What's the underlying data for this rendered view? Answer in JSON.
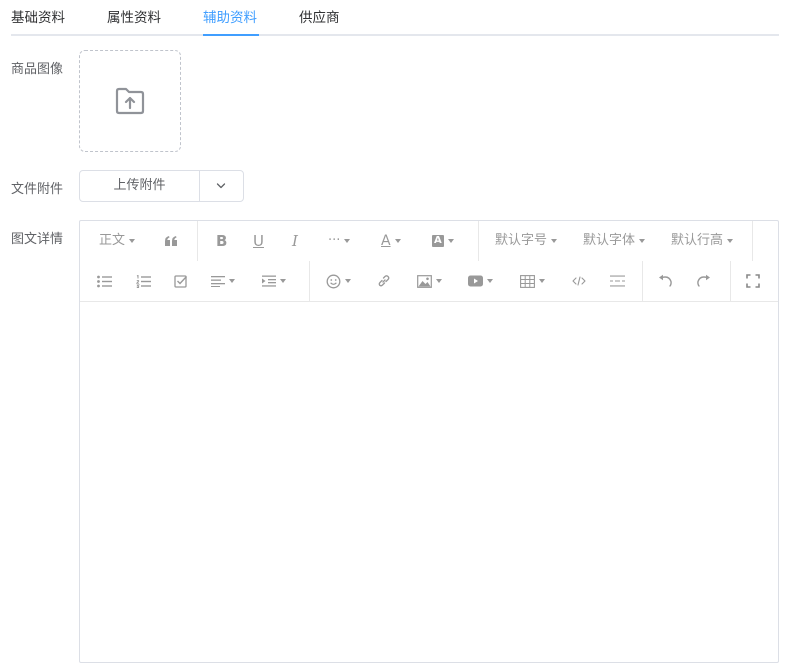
{
  "tabs": [
    {
      "label": "基础资料"
    },
    {
      "label": "属性资料"
    },
    {
      "label": "辅助资料"
    },
    {
      "label": "供应商"
    }
  ],
  "form": {
    "image_label": "商品图像",
    "attachment_label": "文件附件",
    "upload_button_label": "上传附件",
    "detail_label": "图文详情"
  },
  "toolbar": {
    "heading": "正文",
    "font_size": "默认字号",
    "font_family": "默认字体",
    "line_height": "默认行高",
    "font_color_glyph": "A",
    "bg_color_glyph": "A",
    "bold_glyph": "B",
    "underline_glyph": "U",
    "italic_glyph": "I",
    "more_glyph": "···",
    "icons": [
      "quote-icon",
      "bold-icon",
      "underline-icon",
      "italic-icon",
      "more-icon",
      "font-color-icon",
      "bg-color-icon",
      "bulleted-list-icon",
      "numbered-list-icon",
      "todo-icon",
      "justify-icon",
      "indent-icon",
      "emoji-icon",
      "link-icon",
      "image-icon",
      "video-icon",
      "table-icon",
      "code-icon",
      "divider-icon",
      "undo-icon",
      "redo-icon",
      "fullscreen-icon"
    ]
  },
  "colors": {
    "accent": "#409eff",
    "text": "#303133",
    "muted": "#999999",
    "border": "#dcdfe6"
  }
}
